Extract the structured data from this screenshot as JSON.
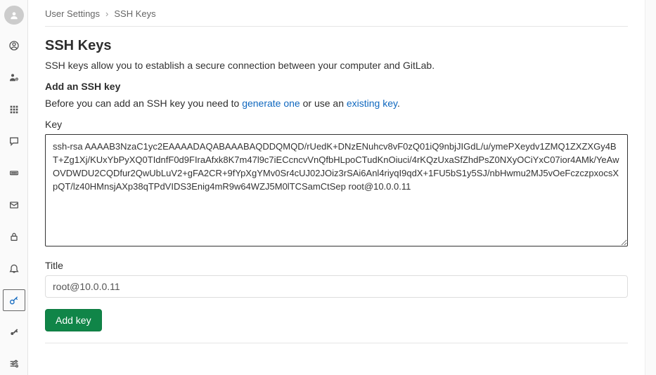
{
  "breadcrumb": {
    "parent": "User Settings",
    "current": "SSH Keys"
  },
  "page": {
    "title": "SSH Keys",
    "description": "SSH keys allow you to establish a secure connection between your computer and GitLab.",
    "subhead": "Add an SSH key",
    "hint_prefix": "Before you can add an SSH key you need to ",
    "hint_link1": "generate one",
    "hint_mid": " or use an ",
    "hint_link2": "existing key",
    "hint_suffix": "."
  },
  "form": {
    "key_label": "Key",
    "key_value": "ssh-rsa AAAAB3NzaC1yc2EAAAADAQABAAABAQDDQMQD/rUedK+DNzENuhcv8vF0zQ01iQ9nbjJIGdL/u/ymePXeydv1ZMQ1ZXZXGy4BT+Zg1Xj/KUxYbPyXQ0TIdnfF0d9FIraAfxk8K7m47l9c7iECcncvVnQfbHLpoCTudKnOiuci/4rKQzUxaSfZhdPsZ0NXyOCiYxC07ior4AMk/YeAwOVDWDU2CQDfur2QwUbLuV2+gFA2CR+9fYpXgYMv0Sr4cUJ02JOiz3rSAi6Anl4riyqI9qdX+1FU5bS1y5SJ/nbHwmu2MJ5vOeFczczpxocsXpQT/lz40HMnsjAXp38qTPdVIDS3Enig4mR9w64WZJ5M0lTCSamCtSep root@10.0.0.11",
    "title_label": "Title",
    "title_value": "root@10.0.0.11",
    "submit_label": "Add key"
  }
}
